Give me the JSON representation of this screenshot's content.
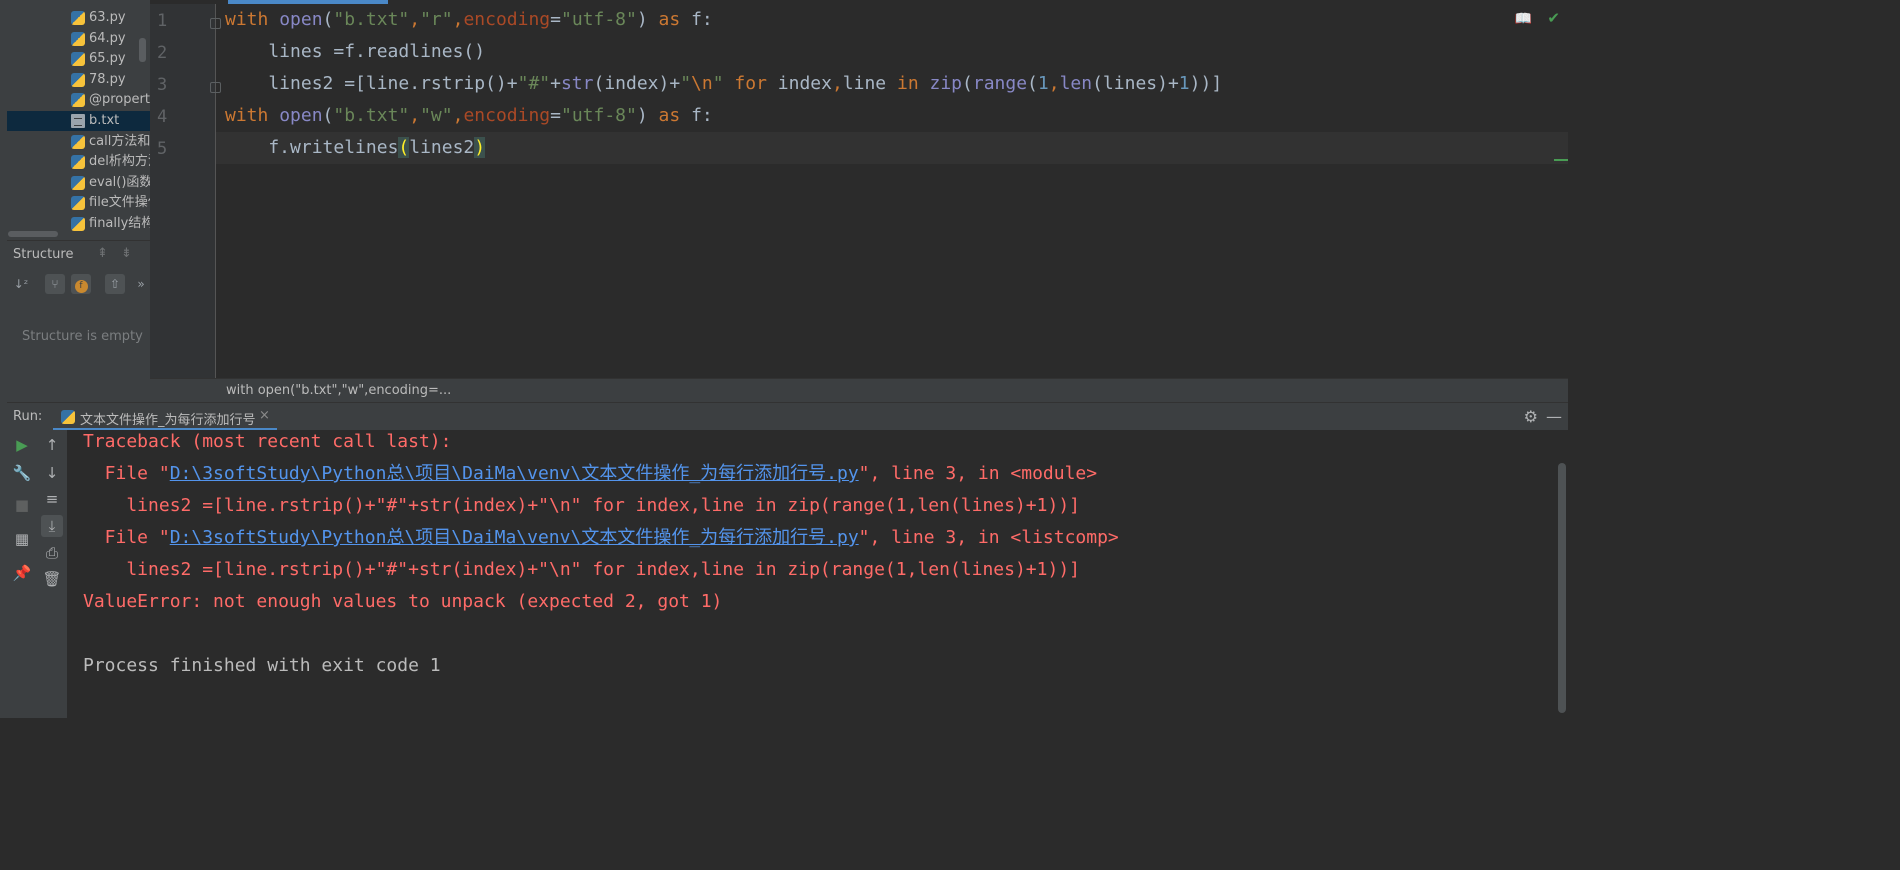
{
  "project_tree": {
    "items": [
      {
        "label": "63.py",
        "icon": "python-file-icon"
      },
      {
        "label": "64.py",
        "icon": "python-file-icon"
      },
      {
        "label": "65.py",
        "icon": "python-file-icon"
      },
      {
        "label": "78.py",
        "icon": "python-file-icon"
      },
      {
        "label": "@property",
        "icon": "python-file-icon"
      },
      {
        "label": "b.txt",
        "icon": "text-file-icon",
        "selected": true
      },
      {
        "label": "call方法和",
        "icon": "python-file-icon"
      },
      {
        "label": "del析构方法",
        "icon": "python-file-icon"
      },
      {
        "label": "eval()函数的",
        "icon": "python-file-icon"
      },
      {
        "label": "file文件操作",
        "icon": "python-file-icon"
      },
      {
        "label": "finally结构",
        "icon": "python-file-icon"
      }
    ]
  },
  "structure": {
    "title": "Structure",
    "empty_text": "Structure is empty",
    "buttons": [
      "sort-alpha-icon",
      "show-inherited-icon",
      "show-fields-icon",
      "navigate-icon",
      "more-icon"
    ],
    "more_label": "»"
  },
  "editor": {
    "line_numbers": [
      "1",
      "2",
      "3",
      "4",
      "5"
    ],
    "lines": [
      [
        [
          "kw",
          "with "
        ],
        [
          "bi",
          "open"
        ],
        [
          "fn",
          "("
        ],
        [
          "st",
          "\"b.txt\""
        ],
        [
          "kw",
          ","
        ],
        [
          "st",
          "\"r\""
        ],
        [
          "kw",
          ","
        ],
        [
          "pm",
          "encoding"
        ],
        [
          "fn",
          "="
        ],
        [
          "st",
          "\"utf-8\""
        ],
        [
          "fn",
          ") "
        ],
        [
          "kw",
          "as "
        ],
        [
          "fn",
          "f:"
        ]
      ],
      [
        [
          "fn",
          "    lines =f.readlines()"
        ]
      ],
      [
        [
          "fn",
          "    lines2 =[line.rstrip()+"
        ],
        [
          "st",
          "\"#\""
        ],
        [
          "fn",
          "+"
        ],
        [
          "bi",
          "str"
        ],
        [
          "fn",
          "(index)+"
        ],
        [
          "st",
          "\""
        ],
        [
          "kw",
          "\\n"
        ],
        [
          "st",
          "\""
        ],
        [
          "fn",
          " "
        ],
        [
          "kw",
          "for "
        ],
        [
          "fn",
          "index"
        ],
        [
          "kw",
          ","
        ],
        [
          "fn",
          "line "
        ],
        [
          "kw",
          "in "
        ],
        [
          "bi",
          "zip"
        ],
        [
          "fn",
          "("
        ],
        [
          "bi",
          "range"
        ],
        [
          "fn",
          "("
        ],
        [
          "nm",
          "1"
        ],
        [
          "kw",
          ","
        ],
        [
          "bi",
          "len"
        ],
        [
          "fn",
          "(lines)+"
        ],
        [
          "nm",
          "1"
        ],
        [
          "fn",
          "))]"
        ]
      ],
      [
        [
          "kw",
          "with "
        ],
        [
          "bi",
          "open"
        ],
        [
          "fn",
          "("
        ],
        [
          "st",
          "\"b.txt\""
        ],
        [
          "kw",
          ","
        ],
        [
          "st",
          "\"w\""
        ],
        [
          "kw",
          ","
        ],
        [
          "pm",
          "encoding"
        ],
        [
          "fn",
          "="
        ],
        [
          "st",
          "\"utf-8\""
        ],
        [
          "fn",
          ") "
        ],
        [
          "kw",
          "as "
        ],
        [
          "fn",
          "f:"
        ]
      ],
      [
        [
          "fn",
          "    f."
        ],
        [
          "fn",
          "writelines"
        ],
        [
          "mc",
          "("
        ],
        [
          "fn",
          "lines2"
        ],
        [
          "mc",
          ")"
        ]
      ]
    ],
    "reader_icon": "reader-mode-icon",
    "check_icon": "inspection-ok-icon"
  },
  "breadcrumb": {
    "text": "with open(\"b.txt\",\"w\",encoding=..."
  },
  "run": {
    "label": "Run:",
    "tab_label": "文本文件操作_为每行添加行号",
    "tab_close": "×",
    "gear_glyph": "⚙",
    "minimize_glyph": "—",
    "toolbar_a": [
      {
        "icon": "rerun-icon",
        "glyph": "▶",
        "color": "#499c54"
      },
      {
        "icon": "wrench-icon",
        "glyph": "🔧",
        "color": "#afb1b3"
      },
      {
        "icon": "stop-icon",
        "glyph": "■",
        "color": "#5e6060"
      },
      {
        "icon": "layout-icon",
        "glyph": "▦",
        "color": "#afb1b3"
      },
      {
        "icon": "pin-icon",
        "glyph": "📌",
        "color": "#afb1b3"
      }
    ],
    "toolbar_b": [
      {
        "icon": "up-arrow-icon",
        "glyph": "↑"
      },
      {
        "icon": "down-arrow-icon",
        "glyph": "↓"
      },
      {
        "icon": "soft-wrap-icon",
        "glyph": "≡"
      },
      {
        "icon": "scroll-to-end-icon",
        "glyph": "⤓",
        "active": true
      },
      {
        "icon": "print-icon",
        "glyph": "⎙"
      },
      {
        "icon": "trash-icon",
        "glyph": "🗑"
      }
    ]
  },
  "console": {
    "lines": [
      {
        "parts": [
          [
            "t",
            "Traceback (most recent call last):"
          ]
        ]
      },
      {
        "parts": [
          [
            "t",
            "  File \""
          ],
          [
            "link",
            "D:\\3softStudy\\Python总\\项目\\DaiMa\\venv\\文本文件操作_为每行添加行号.py"
          ],
          [
            "t",
            "\", line 3, in <module>"
          ]
        ]
      },
      {
        "parts": [
          [
            "t",
            "    lines2 =[line.rstrip()+\"#\"+str(index)+\"\\n\" for index,line in zip(range(1,len(lines)+1))]"
          ]
        ]
      },
      {
        "parts": [
          [
            "t",
            "  File \""
          ],
          [
            "link",
            "D:\\3softStudy\\Python总\\项目\\DaiMa\\venv\\文本文件操作_为每行添加行号.py"
          ],
          [
            "t",
            "\", line 3, in <listcomp>"
          ]
        ]
      },
      {
        "parts": [
          [
            "t",
            "    lines2 =[line.rstrip()+\"#\"+str(index)+\"\\n\" for index,line in zip(range(1,len(lines)+1))]"
          ]
        ]
      },
      {
        "parts": [
          [
            "t",
            "ValueError: not enough values to unpack (expected 2, got 1)"
          ]
        ]
      },
      {
        "parts": [
          [
            "t",
            ""
          ]
        ]
      },
      {
        "normal": true,
        "parts": [
          [
            "t",
            "Process finished with exit code 1"
          ]
        ]
      }
    ]
  }
}
